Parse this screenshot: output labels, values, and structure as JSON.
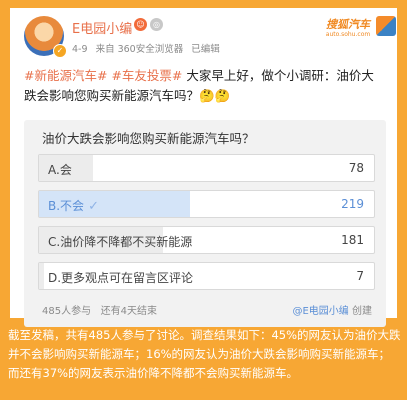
{
  "post": {
    "username": "E电园小编",
    "date": "4-9",
    "source": "来自 360安全浏览器",
    "edited": "已编辑",
    "tag1": "#新能源汽车#",
    "tag2": "#车友投票#",
    "text": " 大家早上好，做个小调研：油价大跌会影响您购买新能源汽车吗？🤔🤔"
  },
  "logo": {
    "brand": "搜狐汽车",
    "domain": "auto.sohu.com"
  },
  "poll": {
    "question": "油价大跌会影响您购买新能源汽车吗？",
    "options": [
      {
        "label": "A.会",
        "count": "78",
        "share": 0.16,
        "selected": false
      },
      {
        "label": "B.不会",
        "count": "219",
        "share": 0.45,
        "selected": true
      },
      {
        "label": "C.油价降不降都不买新能源",
        "count": "181",
        "share": 0.37,
        "selected": false
      },
      {
        "label": "D.更多观点可在留言区评论",
        "count": "7",
        "share": 0.015,
        "selected": false
      }
    ],
    "participants": "485人参与",
    "remaining": "还有4天结束",
    "author": "@E电园小编",
    "created": "创建"
  },
  "caption": "截至发稿，共有485人参与了讨论。调查结果如下：45%的网友认为油价大跌并不会影响购买新能源车；16%的网友认为油价大跌会影响购买新能源车；而还有37%的网友表示油价降不降都不会购买新能源车。",
  "colors": {
    "background": "#f7a734",
    "accent": "#e8704a",
    "selected": "#5b8fd6"
  }
}
